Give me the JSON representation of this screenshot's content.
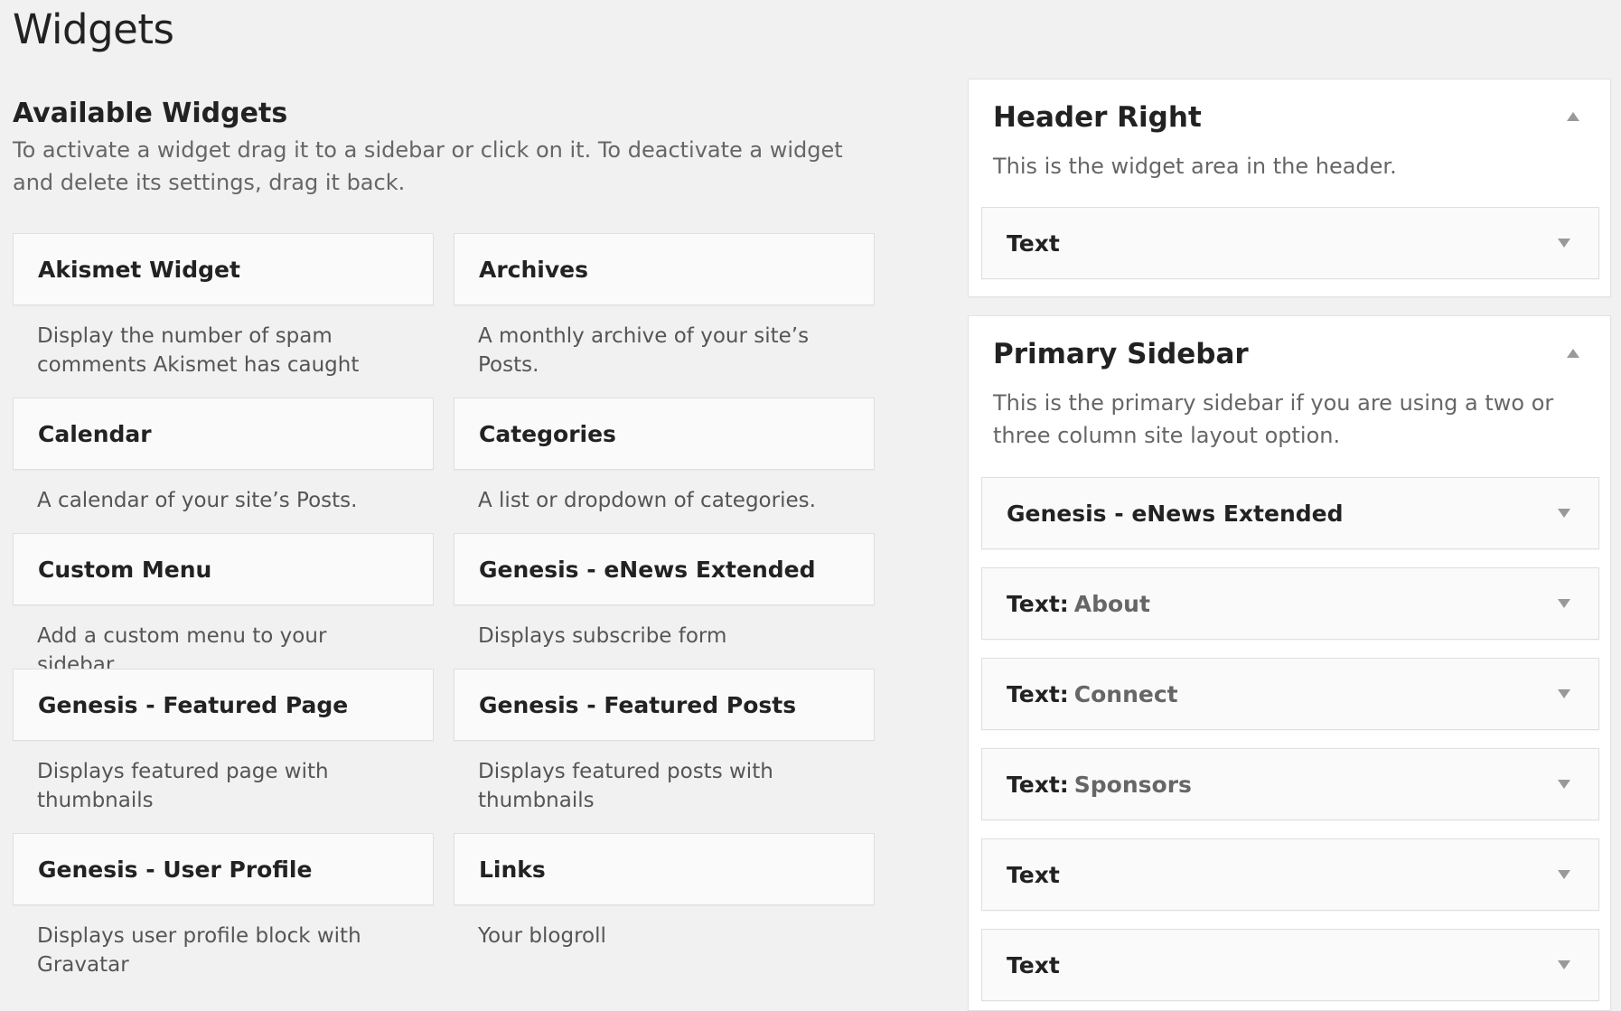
{
  "page": {
    "title": "Widgets"
  },
  "available": {
    "heading": "Available Widgets",
    "description": "To activate a widget drag it to a sidebar or click on it. To deactivate a widget and delete its settings, drag it back.",
    "widgets": [
      {
        "name": "Akismet Widget",
        "description": "Display the number of spam comments Akismet has caught"
      },
      {
        "name": "Archives",
        "description": "A monthly archive of your site’s Posts."
      },
      {
        "name": "Calendar",
        "description": "A calendar of your site’s Posts."
      },
      {
        "name": "Categories",
        "description": "A list or dropdown of categories."
      },
      {
        "name": "Custom Menu",
        "description": "Add a custom menu to your sidebar."
      },
      {
        "name": "Genesis - eNews Extended",
        "description": "Displays subscribe form"
      },
      {
        "name": "Genesis - Featured Page",
        "description": "Displays featured page with thumbnails"
      },
      {
        "name": "Genesis - Featured Posts",
        "description": "Displays featured posts with thumbnails"
      },
      {
        "name": "Genesis - User Profile",
        "description": "Displays user profile block with Gravatar"
      },
      {
        "name": "Links",
        "description": "Your blogroll"
      }
    ]
  },
  "sidebars": [
    {
      "name": "Header Right",
      "description": "This is the widget area in the header.",
      "widgets": [
        {
          "name": "Text",
          "title": ""
        }
      ]
    },
    {
      "name": "Primary Sidebar",
      "description": "This is the primary sidebar if you are using a two or three column site layout option.",
      "widgets": [
        {
          "name": "Genesis - eNews Extended",
          "title": ""
        },
        {
          "name": "Text",
          "title": "About"
        },
        {
          "name": "Text",
          "title": "Connect"
        },
        {
          "name": "Text",
          "title": "Sponsors"
        },
        {
          "name": "Text",
          "title": ""
        },
        {
          "name": "Text",
          "title": ""
        }
      ]
    }
  ],
  "colors": {
    "background": "#f1f1f1",
    "panel": "#ffffff",
    "widget_bar": "#fafafa",
    "muted_text": "#666666"
  },
  "icons": {
    "collapse": "triangle-up-icon",
    "expand": "triangle-down-icon"
  }
}
